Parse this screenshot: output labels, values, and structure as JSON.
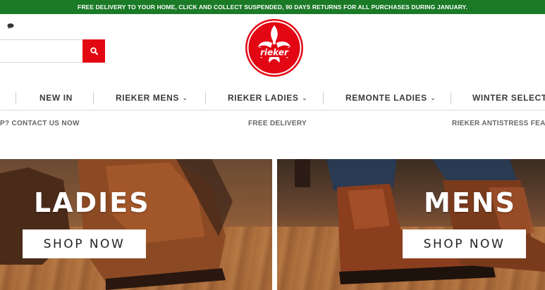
{
  "announcement": "FREE DELIVERY TO YOUR HOME, CLICK AND COLLECT SUSPENDED, 90 DAYS RETURNS FOR ALL PURCHASES DURING JANUARY.",
  "header": {
    "search": {
      "value": "",
      "placeholder": ""
    },
    "logo_text": "rieker"
  },
  "nav": {
    "items": [
      {
        "label": "NEW IN"
      },
      {
        "label": "RIEKER MENS"
      },
      {
        "label": "RIEKER LADIES"
      },
      {
        "label": "REMONTE LADIES"
      },
      {
        "label": "WINTER SELECTION"
      }
    ]
  },
  "usp": {
    "contact": "P? CONTACT US NOW",
    "delivery": "FREE DELIVERY",
    "antistress": "RIEKER ANTISTRESS FEATURES"
  },
  "promos": {
    "ladies": {
      "title": "LADIES",
      "button": "SHOP NOW"
    },
    "mens": {
      "title": "MENS",
      "button": "SHOP NOW"
    }
  },
  "colors": {
    "topbar": "#1a7a26",
    "brand_red": "#e30613",
    "nav_text": "#3a3a3a"
  },
  "icons": [
    "chat-icon",
    "search-icon",
    "rieker-logo",
    "chevron-down-icon"
  ]
}
